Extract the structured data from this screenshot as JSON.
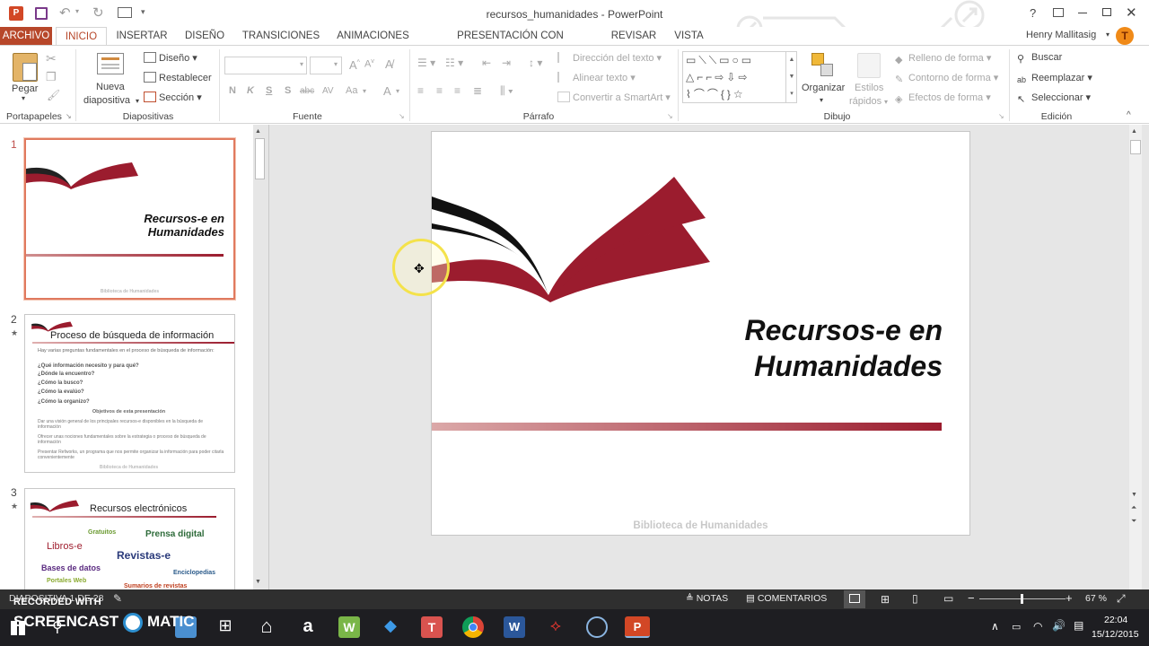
{
  "window": {
    "title": "recursos_humanidades - PowerPoint",
    "help": "?"
  },
  "tabs": [
    {
      "label": "ARCHIVO"
    },
    {
      "label": "INICIO"
    },
    {
      "label": "INSERTAR"
    },
    {
      "label": "DISEÑO"
    },
    {
      "label": "TRANSICIONES"
    },
    {
      "label": "ANIMACIONES"
    },
    {
      "label": "PRESENTACIÓN CON DIAPOSITIVAS"
    },
    {
      "label": "REVISAR"
    },
    {
      "label": "VISTA"
    }
  ],
  "user": {
    "name": "Henry Mallitasig",
    "initial": "T"
  },
  "ribbon": {
    "portapapeles": {
      "label": "Portapapeles",
      "pegar": "Pegar"
    },
    "diapositivas": {
      "label": "Diapositivas",
      "nueva_1": "Nueva",
      "nueva_2": "diapositiva",
      "diseno": "Diseño",
      "restablecer": "Restablecer",
      "seccion": "Sección"
    },
    "fuente": {
      "label": "Fuente",
      "bold": "N",
      "italic": "K",
      "underline": "S",
      "shadow": "S",
      "strike": "abc",
      "spacing": "AV",
      "case": "Aa",
      "color": "A"
    },
    "parrafo": {
      "label": "Párrafo",
      "direccion": "Dirección del texto",
      "alinear": "Alinear texto",
      "smartart": "Convertir a SmartArt"
    },
    "dibujo": {
      "label": "Dibujo",
      "organizar": "Organizar",
      "estilos_1": "Estilos",
      "estilos_2": "rápidos",
      "relleno": "Relleno de forma",
      "contorno": "Contorno de forma",
      "efectos": "Efectos de forma"
    },
    "edicion": {
      "label": "Edición",
      "buscar": "Buscar",
      "reemplazar": "Reemplazar",
      "seleccionar": "Seleccionar"
    }
  },
  "slides": [
    {
      "num": "1",
      "title_1": "Recursos-e en",
      "title_2": "Humanidades",
      "footer": "Biblioteca de Humanidades"
    },
    {
      "num": "2",
      "title": "Proceso de búsqueda de información",
      "intro": "Hay varias preguntas fundamentales en el proceso de búsqueda de información:",
      "questions": [
        "¿Qué información necesito y para qué?",
        "¿Dónde la encuentro?",
        "¿Cómo la busco?",
        "¿Cómo la evalúo?",
        "¿Cómo la organizo?"
      ],
      "objectives_title": "Objetivos de esta presentación",
      "bullets": [
        "Dar una visión general de los principales recursos-e disponibles en la búsqueda de información",
        "Ofrecer unas nociones fundamentales sobre la estrategia o proceso de búsqueda de información",
        "Presentar Refworks, un programa que nos permite organizar la información para poder citarla convenientemente"
      ],
      "footer": "Biblioteca de Humanidades"
    },
    {
      "num": "3",
      "title": "Recursos electrónicos",
      "words": {
        "gratuitos": "Gratuitos",
        "prensa": "Prensa digital",
        "libros": "Libros-e",
        "revistas": "Revistas-e",
        "bases": "Bases de datos",
        "enciclopedias": "Enciclopedias",
        "portales": "Portales Web",
        "sumarios": "Sumarios de revistas"
      }
    }
  ],
  "main_slide": {
    "title_1": "Recursos-e en",
    "title_2": "Humanidades",
    "footer": "Biblioteca de Humanidades"
  },
  "status": {
    "slide_info": "DIAPOSITIVA 1 DE 28",
    "notas": "NOTAS",
    "comentarios": "COMENTARIOS",
    "zoom": "67 %",
    "zoom_fraction": 0.48
  },
  "watermark": {
    "line1": "RECORDED WITH",
    "line2a": "SCREENCAST",
    "line2b": "MATIC"
  },
  "taskbar": {
    "time": "22:04",
    "date": "15/12/2015"
  },
  "colors": {
    "accent": "#b7472a",
    "brand_red": "#9b1c2e",
    "status_bg": "#2f2f2f"
  }
}
